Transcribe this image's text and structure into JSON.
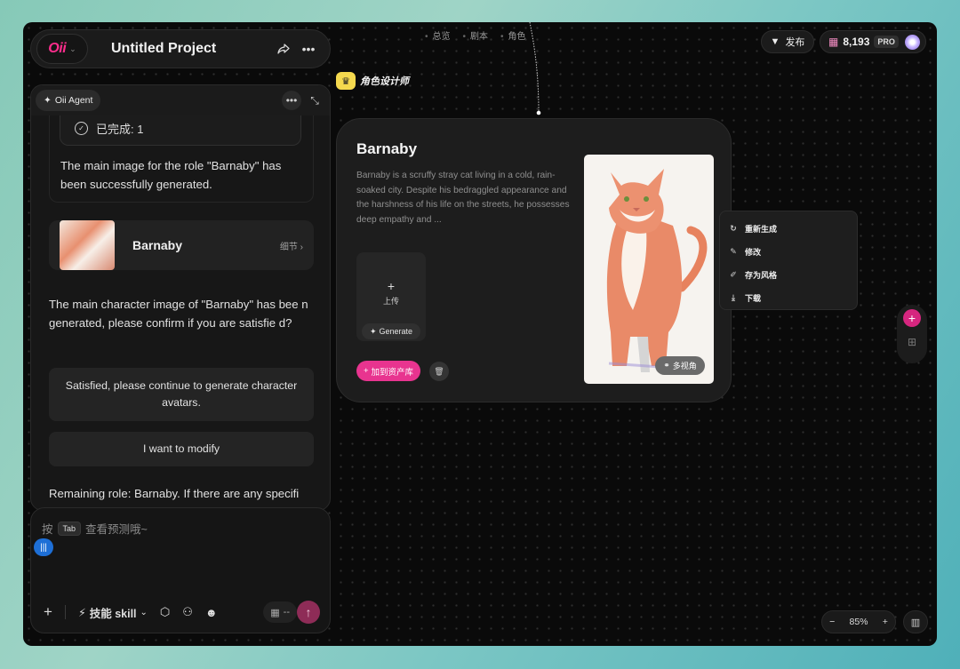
{
  "header": {
    "logo_text": "Oii",
    "project_title": "Untitled Project",
    "breadcrumbs": [
      "总览",
      "剧本",
      "角色"
    ],
    "publish_label": "发布",
    "credits": "8,193",
    "plan_badge": "PRO"
  },
  "agent": {
    "name": "Oii Agent",
    "completed_label": "已完成: 1",
    "msg1": "The main image for the role \"Barnaby\" has been successfully generated.",
    "character_card": {
      "name": "Barnaby",
      "detail_label": "细节 ›"
    },
    "msg2": "The main character image of \"Barnaby\" has bee n generated, please confirm if you are satisfie d?",
    "option1": "Satisfied, please continue to generate character avatars.",
    "option2": "I want to modify",
    "msg3": "Remaining role: Barnaby. If there are any specifi"
  },
  "input": {
    "placeholder_prefix": "按",
    "tab_key": "Tab",
    "placeholder_suffix": "查看预测哦~",
    "skill_label": "技能 skill",
    "model_label": "--"
  },
  "node": {
    "role_tag": "角色设计师",
    "title": "Barnaby",
    "description": "Barnaby is a scruffy stray cat living in a cold, rain-soaked city. Despite his bedraggled appearance and the harshness of his life on the streets, he possesses deep empathy and ...",
    "upload_label": "上传",
    "generate_label": "Generate",
    "add_library_label": "加到资产库",
    "multiview_label": "多视角"
  },
  "context_menu": {
    "items": [
      "重新生成",
      "修改",
      "存为风格",
      "下载"
    ]
  },
  "zoom": {
    "level": "85%"
  },
  "colors": {
    "accent": "#e8348f",
    "voice": "#1e6fd6",
    "crown": "#f5d94e"
  }
}
